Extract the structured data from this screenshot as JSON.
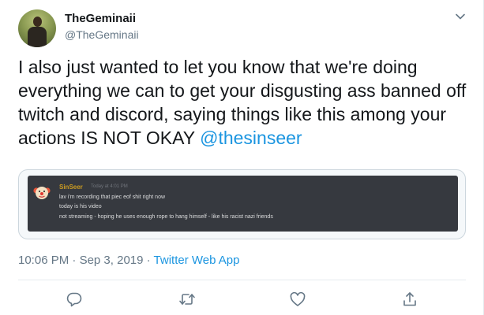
{
  "tweet": {
    "display_name": "TheGeminaii",
    "handle": "@TheGeminaii",
    "text": "I also just wanted to let you know that we're doing everything we can to get your disgusting ass banned off twitch and discord, saying things like this among your actions IS NOT OKAY ",
    "mention": "@thesinseer",
    "time": "10:06 PM",
    "date": "Sep 3, 2019",
    "source": "Twitter Web App"
  },
  "embedded_image": {
    "username": "SinSeer",
    "timestamp": "Today at 4:01 PM",
    "messages": [
      "lav i'm recording that piec eof shit right now",
      "today is his video",
      "not streaming - hoping he uses enough rope to hang himself - like his racist nazi friends"
    ]
  },
  "icons": {
    "caret": "chevron-down-icon",
    "reply": "reply-icon",
    "retweet": "retweet-icon",
    "like": "heart-icon",
    "share": "share-icon"
  },
  "colors": {
    "link": "#1b95e0",
    "secondary_text": "#657786",
    "discord_bg": "#36393f",
    "discord_username": "#c99a22"
  }
}
